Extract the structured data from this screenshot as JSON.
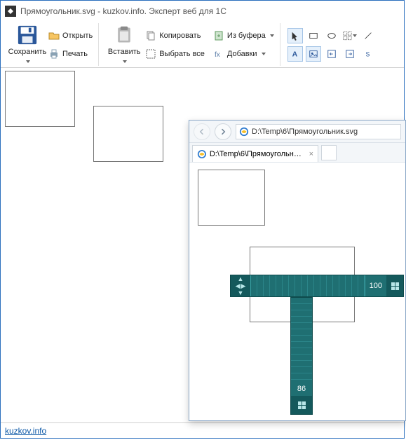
{
  "window": {
    "title": "Прямоугольник.svg - kuzkov.info. Эксперт веб для 1С"
  },
  "ribbon": {
    "save_label": "Сохранить",
    "open_label": "Открыть",
    "print_label": "Печать",
    "paste_label": "Вставить",
    "copy_label": "Копировать",
    "selectall_label": "Выбрать все",
    "fromclipboard_label": "Из буфера",
    "addons_label": "Добавки"
  },
  "statusbar": {
    "link": "kuzkov.info"
  },
  "ie": {
    "url": "D:\\Temp\\6\\Прямоугольник.svg",
    "tab_label": "D:\\Temp\\6\\Прямоугольни..."
  },
  "ruler": {
    "width_value": "100",
    "height_value": "86"
  }
}
